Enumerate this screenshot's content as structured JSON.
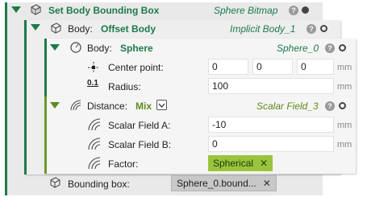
{
  "root": {
    "title": "Set Body Bounding Box",
    "type": "Sphere Bitmap",
    "bounding_box_label": "Bounding box:",
    "bounding_box_value": "Sphere_0.bound..."
  },
  "body_block": {
    "label": "Body:",
    "name": "Offset Body",
    "type": "Implicit Body_1"
  },
  "sphere_block": {
    "label": "Body:",
    "name": "Sphere",
    "type": "Sphere_0",
    "center_label": "Center point:",
    "center_values": [
      "0",
      "0",
      "0"
    ],
    "radius_label": "Radius:",
    "radius_value": "100",
    "unit": "mm"
  },
  "distance_block": {
    "label": "Distance:",
    "mode": "Mix",
    "type": "Scalar Field_3",
    "scalar_a_label": "Scalar Field A:",
    "scalar_a_value": "-10",
    "scalar_b_label": "Scalar Field B:",
    "scalar_b_value": "0",
    "factor_label": "Factor:",
    "factor_value": "Spherical",
    "unit": "mm"
  },
  "icons": {
    "help": "?",
    "chip_close": "✕",
    "radius_symbol": "0.1"
  },
  "colors": {
    "accent_green": "#1e7a4a",
    "accent_olive": "#5f8a1e",
    "chip_green": "#9ac43d"
  }
}
